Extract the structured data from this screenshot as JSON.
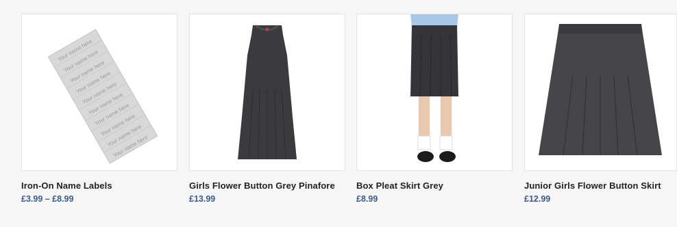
{
  "products": [
    {
      "title": "Iron-On Name Labels",
      "price": "£3.99 – £8.99",
      "label_text": "Your name here"
    },
    {
      "title": "Girls Flower Button Grey Pinafore",
      "price": "£13.99"
    },
    {
      "title": "Box Pleat Skirt Grey",
      "price": "£8.99"
    },
    {
      "title": "Junior Girls Flower Button Skirt",
      "price": "£12.99"
    }
  ],
  "colors": {
    "price": "#3b5a8e",
    "garment": "#3b3b3d"
  }
}
